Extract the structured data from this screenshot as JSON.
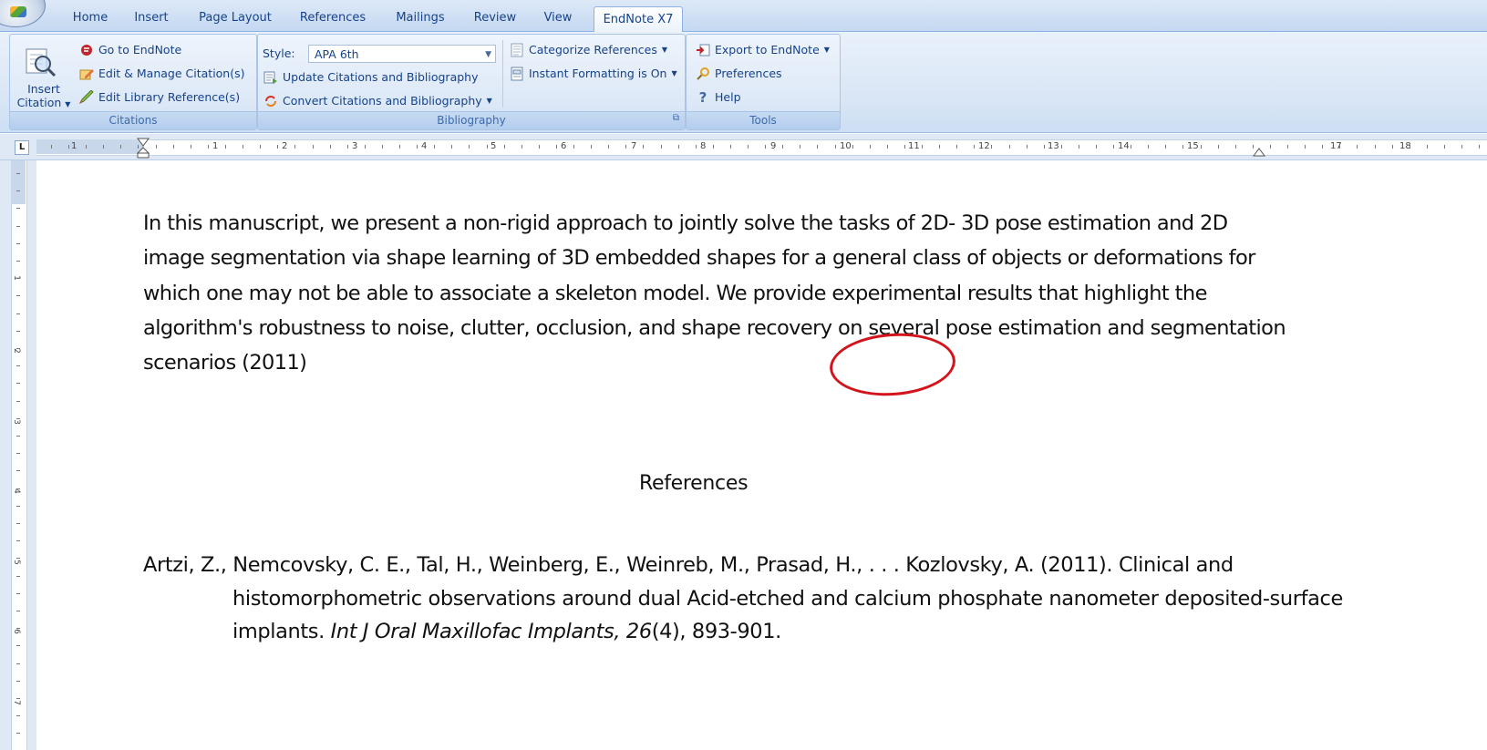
{
  "tabs": [
    "Home",
    "Insert",
    "Page Layout",
    "References",
    "Mailings",
    "Review",
    "View",
    "EndNote X7"
  ],
  "active_tab": "EndNote X7",
  "ribbon": {
    "citations": {
      "insert_citation": "Insert",
      "insert_citation_2": "Citation",
      "go_to_endnote": "Go to EndNote",
      "edit_manage": "Edit & Manage Citation(s)",
      "edit_library": "Edit Library Reference(s)",
      "label": "Citations"
    },
    "bibliography": {
      "style_label": "Style:",
      "style_value": "APA 6th",
      "update": "Update Citations and Bibliography",
      "convert": "Convert Citations and Bibliography",
      "categorize": "Categorize References",
      "instant": "Instant Formatting is On",
      "label": "Bibliography"
    },
    "tools": {
      "export": "Export to EndNote",
      "preferences": "Preferences",
      "help": "Help",
      "label": "Tools"
    }
  },
  "ruler": {
    "numbers": [
      "1",
      "1",
      "2",
      "3",
      "4",
      "5",
      "6",
      "7",
      "8",
      "9",
      "10",
      "11",
      "12",
      "13",
      "14",
      "15",
      "17",
      "18"
    ],
    "vertical_numbers": [
      "1",
      "2",
      "3",
      "4",
      "5",
      "6",
      "7"
    ]
  },
  "document": {
    "paragraph": "In this manuscript, we present a non-rigid approach to jointly solve the tasks of 2D- 3D pose estimation and 2D image segmentation via shape learning of 3D embedded shapes for a general class of objects or deformations for which one may not be able to associate a skeleton model. We provide experimental results that highlight the algorithm's robustness to noise, clutter, occlusion, and shape recovery on several pose estimation and segmentation scenarios",
    "citation": "(2011)",
    "references_heading": "References",
    "reference": {
      "authors": "Artzi, Z., Nemcovsky, C. E., Tal, H., Weinberg, E., Weinreb, M., Prasad, H., . . . Kozlovsky, A. (2011). Clinical and histomorphometric observations around dual Acid-etched and calcium phosphate nanometer deposited-surface implants.",
      "journal": "Int J Oral Maxillofac Implants,",
      "volume": "26",
      "issue_pages": "(4), 893-901."
    }
  },
  "colors": {
    "ribbon_text": "#15428b",
    "highlight_circle": "#d4141c"
  }
}
